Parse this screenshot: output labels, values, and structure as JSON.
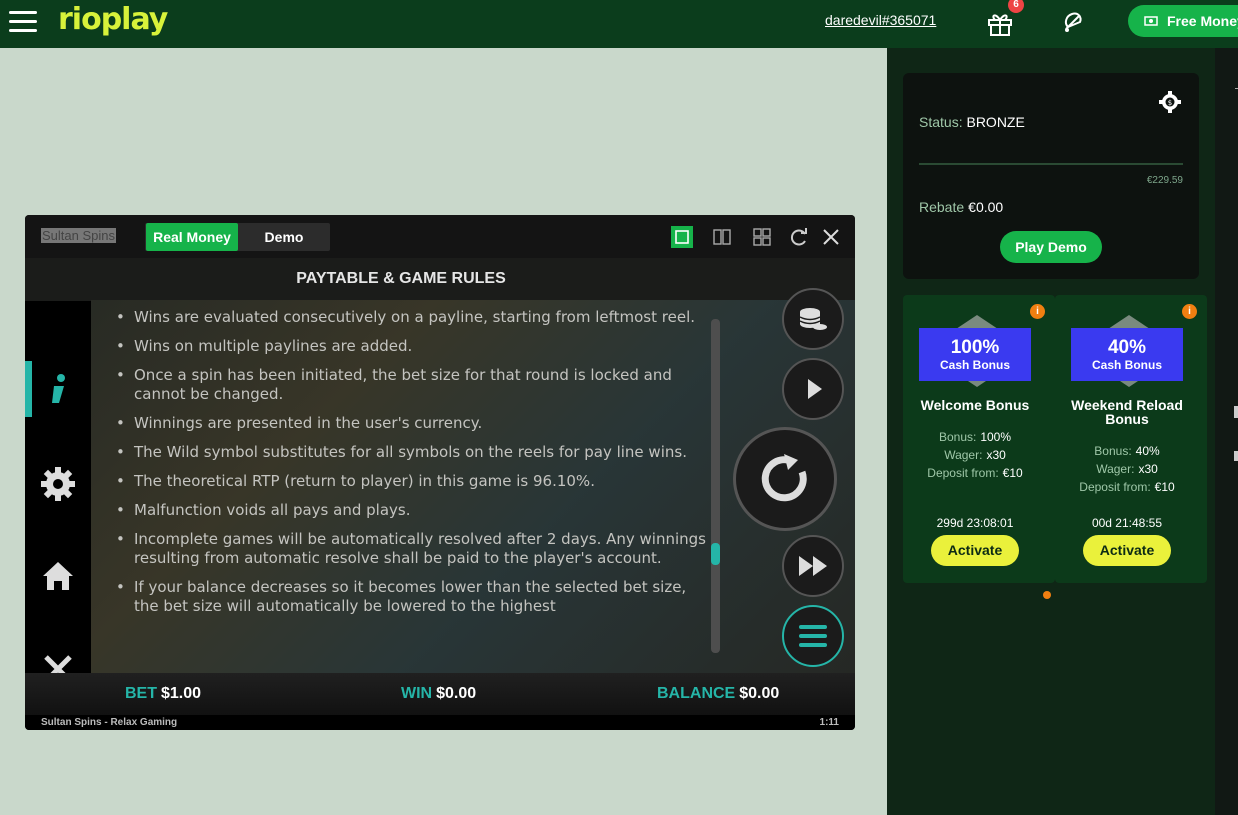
{
  "header": {
    "logo": "rioplay",
    "username": "daredevil#365071",
    "gift_count": "6",
    "free_money_label": "Free Money"
  },
  "status_card": {
    "status_label": "Status:",
    "status_value": "BRONZE",
    "progress_fraction": 0.0,
    "target_amount": "€229.59",
    "rebate_label": "Rebate",
    "rebate_value": "€0.00",
    "play_demo_label": "Play Demo"
  },
  "bonuses": [
    {
      "pct": "100%",
      "sub": "Cash Bonus",
      "title": "Welcome Bonus",
      "bonus_label": "Bonus:",
      "bonus_value": "100%",
      "wager_label": "Wager:",
      "wager_value": "x30",
      "deposit_label": "Deposit from:",
      "deposit_value": "€10",
      "timer": "299d  23:08:01",
      "activate_label": "Activate"
    },
    {
      "pct": "40%",
      "sub": "Cash Bonus",
      "title": "Weekend Reload Bonus",
      "bonus_label": "Bonus:",
      "bonus_value": "40%",
      "wager_label": "Wager:",
      "wager_value": "x30",
      "deposit_label": "Deposit from:",
      "deposit_value": "€10",
      "timer": "00d  21:48:55",
      "activate_label": "Activate"
    }
  ],
  "game": {
    "title": "Sultan Spins",
    "mode_real": "Real Money",
    "mode_demo": "Demo",
    "paytable_title": "PAYTABLE & GAME RULES",
    "rules": [
      "Wins are evaluated consecutively on a payline, starting from leftmost reel.",
      "Wins on multiple paylines are added.",
      "Once a spin has been initiated, the bet size for that round is locked and cannot be changed.",
      "Winnings are presented in the user's currency.",
      "The Wild symbol substitutes for all symbols on the reels for pay line wins.",
      "The theoretical RTP (return to player) in this game is 96.10%.",
      "Malfunction voids all pays and plays.",
      "Incomplete games will be automatically resolved after 2 days. Any winnings resulting from automatic resolve shall be paid to the player's account.",
      "If your balance decreases so it becomes lower than the selected bet size, the bet size will automatically be lowered to the highest"
    ],
    "bet_label": "BET",
    "bet_value": "$1.00",
    "win_label": "WIN",
    "win_value": "$0.00",
    "balance_label": "BALANCE",
    "balance_value": "$0.00",
    "footer_left": "Sultan Spins - Relax Gaming",
    "footer_right": "1:11"
  },
  "icons": [
    "menu-icon",
    "gift-icon",
    "bell-icon",
    "money-icon",
    "settings-icon",
    "info-icon",
    "gear-icon",
    "home-icon",
    "close-icon",
    "coins-icon",
    "play-icon",
    "spin-icon",
    "fast-forward-icon",
    "menu-lines-icon",
    "single-view-icon",
    "split-view-icon",
    "grid-view-icon",
    "refresh-icon",
    "window-close-icon"
  ],
  "colors": {
    "brand_green": "#16b34a",
    "accent_teal": "#25b5a8",
    "header_bg": "#0b3d1c",
    "logo_yellow": "#d8f23a",
    "badge_blue": "#3a3af0",
    "activate_yellow": "#eaf13b",
    "info_orange": "#f07f11"
  }
}
